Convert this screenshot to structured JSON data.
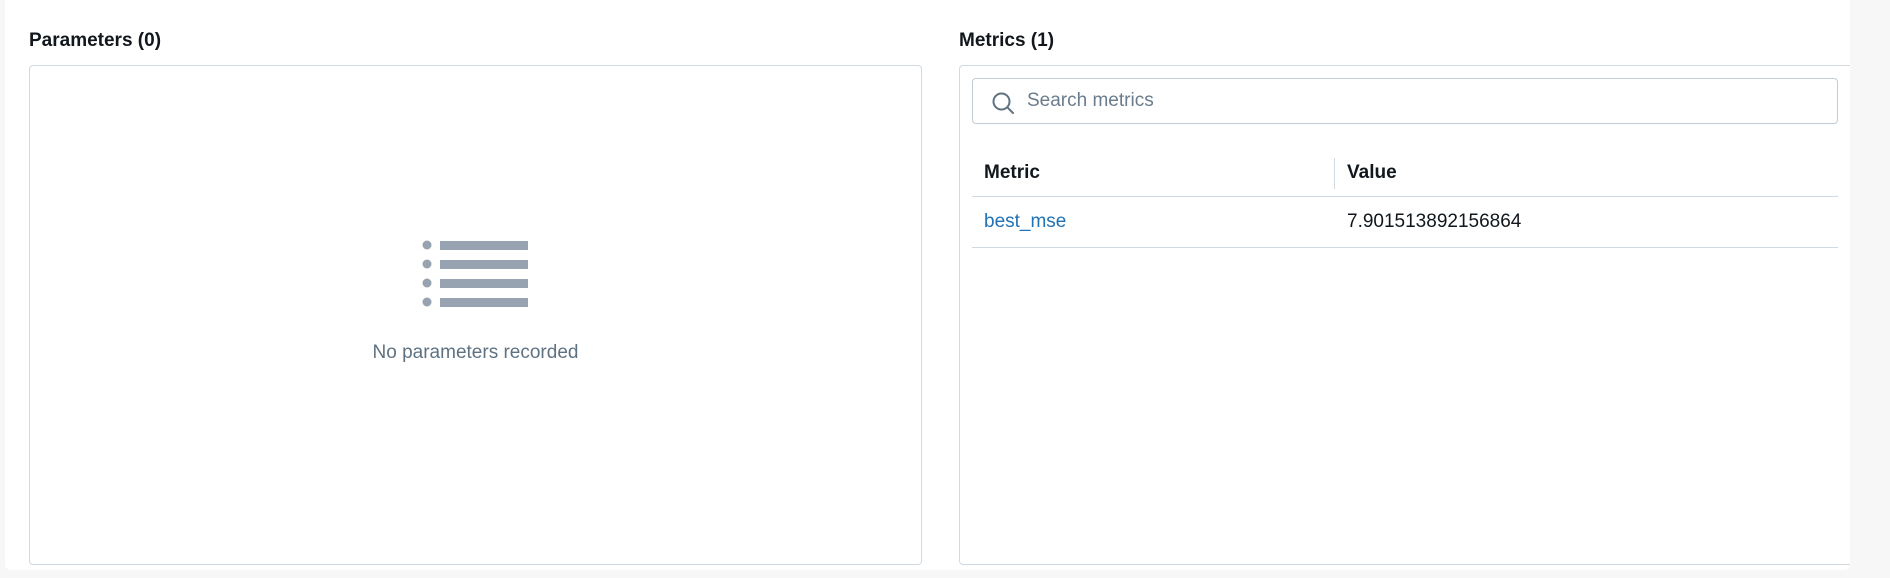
{
  "parameters": {
    "title": "Parameters (0)",
    "empty_message": "No parameters recorded",
    "empty_icon": "list-icon"
  },
  "metrics": {
    "title": "Metrics (1)",
    "search": {
      "placeholder": "Search metrics",
      "value": "",
      "icon": "search-icon"
    },
    "columns": [
      "Metric",
      "Value"
    ],
    "rows": [
      {
        "metric": "best_mse",
        "value": "7.901513892156864"
      }
    ]
  },
  "colors": {
    "link": "#2272b4",
    "muted_text": "#5f7281",
    "icon_gray": "#97a3b0",
    "border": "#d1d9e1"
  }
}
